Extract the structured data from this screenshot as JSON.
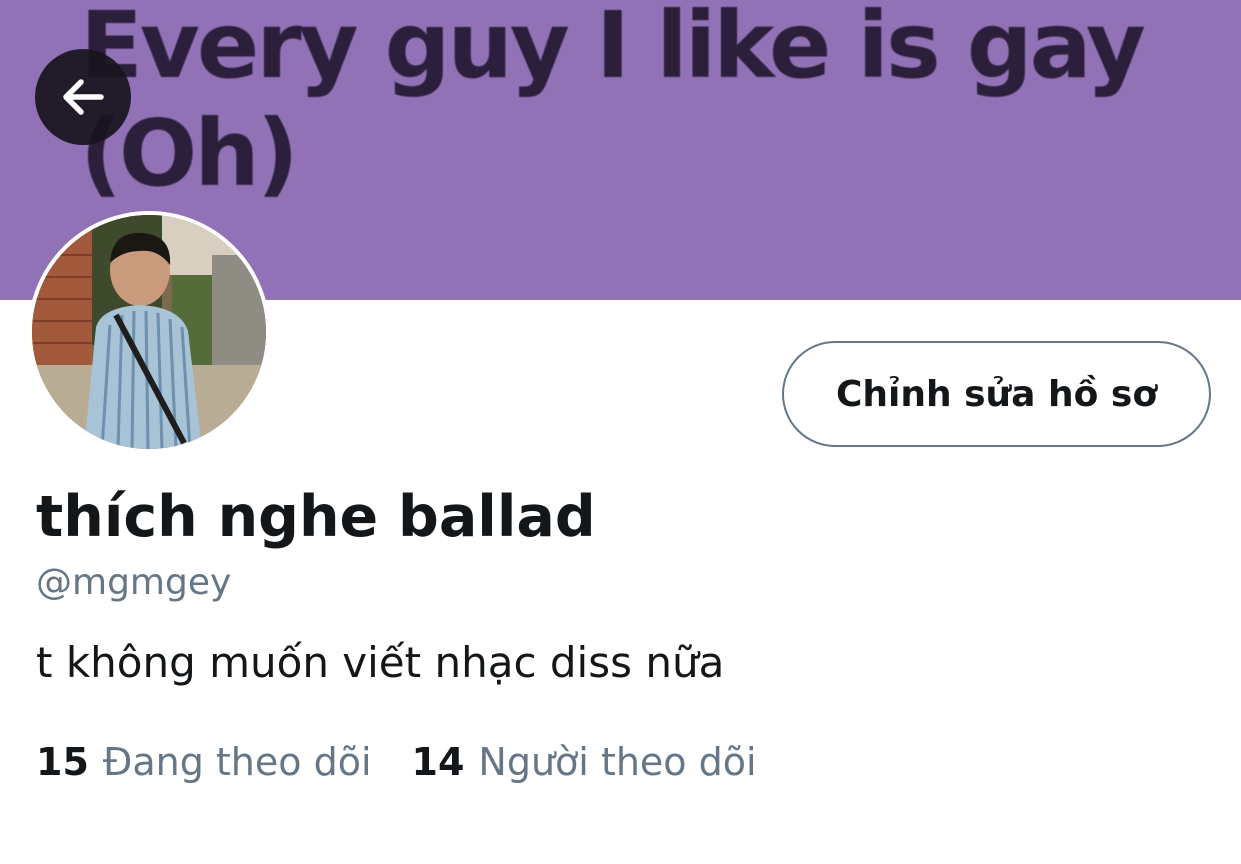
{
  "banner": {
    "text": "Every guy I like is gay\n(Oh)",
    "background_color": "#9272b6"
  },
  "back_button": {
    "icon": "arrow-left-icon"
  },
  "avatar": {
    "description_icon": "profile-photo"
  },
  "edit_profile": {
    "label": "Chỉnh sửa hồ sơ"
  },
  "profile": {
    "display_name": "thích nghe ballad",
    "handle": "@mgmgey",
    "bio": "t không muốn viết nhạc diss nữa"
  },
  "stats": {
    "following": {
      "count": "15",
      "label": "Đang theo dõi"
    },
    "followers": {
      "count": "14",
      "label": "Người theo dõi"
    }
  },
  "colors": {
    "text_primary": "#14171a",
    "text_secondary": "#657786"
  }
}
